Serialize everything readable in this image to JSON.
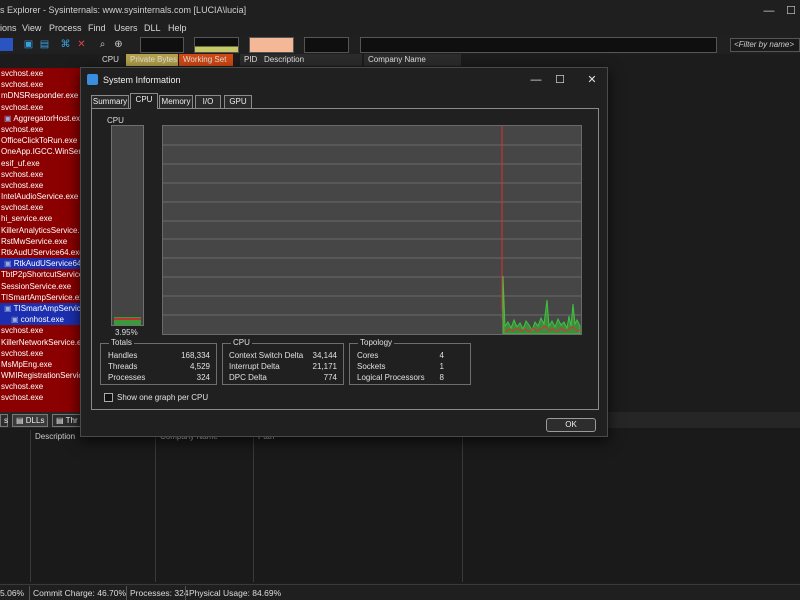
{
  "window": {
    "title": "s Explorer - Sysinternals: www.sysinternals.com [LUCIA\\lucia]"
  },
  "menu": [
    "ions",
    "View",
    "Process",
    "Find",
    "Users",
    "DLL",
    "Help"
  ],
  "toolbar": {
    "filter_placeholder": "<Filter by name>"
  },
  "columns": {
    "cpu": "CPU",
    "private_bytes": "Private Bytes",
    "working_set": "Working Set",
    "pid": "PID",
    "description": "Description",
    "company": "Company Name"
  },
  "processes": [
    {
      "name": "svchost.exe",
      "kind": "svc"
    },
    {
      "name": "svchost.exe",
      "kind": "svc"
    },
    {
      "name": "mDNSResponder.exe",
      "kind": "svc"
    },
    {
      "name": "svchost.exe",
      "kind": "svc"
    },
    {
      "name": "AggregatorHost.exe",
      "kind": "svc",
      "icon": true
    },
    {
      "name": "svchost.exe",
      "kind": "svc"
    },
    {
      "name": "OfficeClickToRun.exe",
      "kind": "svc"
    },
    {
      "name": "OneApp.IGCC.WinServic",
      "kind": "svc"
    },
    {
      "name": "esif_uf.exe",
      "kind": "svc"
    },
    {
      "name": "svchost.exe",
      "kind": "svc"
    },
    {
      "name": "svchost.exe",
      "kind": "svc"
    },
    {
      "name": "IntelAudioService.exe",
      "kind": "svc"
    },
    {
      "name": "svchost.exe",
      "kind": "svc"
    },
    {
      "name": "hi_service.exe",
      "kind": "svc"
    },
    {
      "name": "KillerAnalyticsService.ex",
      "kind": "svc"
    },
    {
      "name": "RstMwService.exe",
      "kind": "svc"
    },
    {
      "name": "RtkAudUService64.exe",
      "kind": "svc"
    },
    {
      "name": "RtkAudUService64.e",
      "kind": "blue",
      "icon": true
    },
    {
      "name": "TbtP2pShortcutService.",
      "kind": "svc"
    },
    {
      "name": "SessionService.exe",
      "kind": "svc"
    },
    {
      "name": "TISmartAmpService.exe",
      "kind": "svc"
    },
    {
      "name": "TISmartAmpService.e",
      "kind": "blue",
      "icon": true
    },
    {
      "name": "conhost.exe",
      "kind": "sel",
      "icon": true
    },
    {
      "name": "svchost.exe",
      "kind": "svc"
    },
    {
      "name": "KillerNetworkService.exe",
      "kind": "svc"
    },
    {
      "name": "svchost.exe",
      "kind": "svc"
    },
    {
      "name": "MsMpEng.exe",
      "kind": "svc"
    },
    {
      "name": "WMIRegistrationService",
      "kind": "svc"
    },
    {
      "name": "svchost.exe",
      "kind": "svc"
    },
    {
      "name": "svchost.exe",
      "kind": "svc"
    }
  ],
  "lower": {
    "tabs": [
      "s",
      "DLLs",
      "Thr"
    ],
    "columns": [
      "Description",
      "Company Name",
      "Path"
    ]
  },
  "status": {
    "cpu": "5.06%",
    "commit": "Commit Charge: 46.70%",
    "processes": "Processes: 324",
    "physical": "Physical Usage: 84.69%"
  },
  "dialog": {
    "title": "System Information",
    "tabs": [
      "Summary",
      "CPU",
      "Memory",
      "I/O",
      "GPU"
    ],
    "active_tab": "CPU",
    "cpu_label": "CPU",
    "cpu_percent": "3.95%",
    "cpu_usage_fraction": 0.0395,
    "totals": {
      "title": "Totals",
      "rows": [
        {
          "label": "Handles",
          "value": "168,334"
        },
        {
          "label": "Threads",
          "value": "4,529"
        },
        {
          "label": "Processes",
          "value": "324"
        }
      ]
    },
    "cpu": {
      "title": "CPU",
      "rows": [
        {
          "label": "Context Switch Delta",
          "value": "34,144"
        },
        {
          "label": "Interrupt Delta",
          "value": "21,171"
        },
        {
          "label": "DPC Delta",
          "value": "774"
        }
      ]
    },
    "topology": {
      "title": "Topology",
      "rows": [
        {
          "label": "Cores",
          "value": "4"
        },
        {
          "label": "Sockets",
          "value": "1"
        },
        {
          "label": "Logical Processors",
          "value": "8"
        }
      ]
    },
    "checkbox_label": "Show one graph per CPU",
    "ok_label": "OK"
  },
  "colors": {
    "service_row": "#8b0000",
    "selected_row": "#1b2fb0",
    "graph_green": "#3ec43e",
    "graph_red": "#e03030"
  }
}
